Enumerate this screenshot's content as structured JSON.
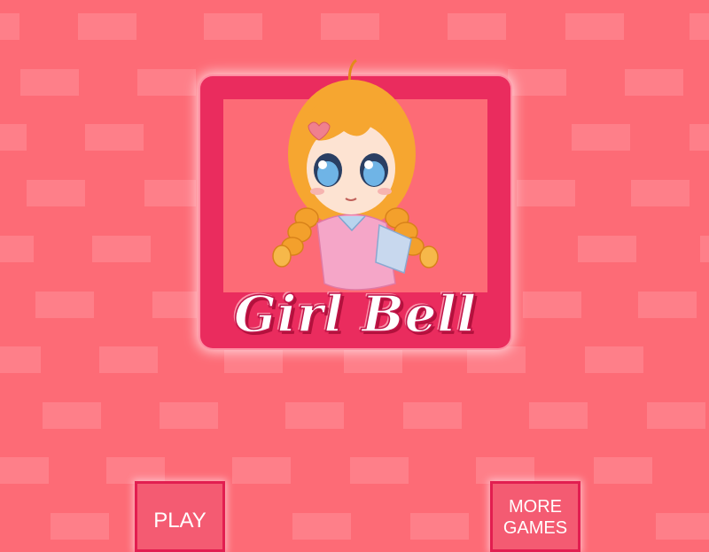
{
  "logo": {
    "title": "Girl Bell",
    "mascot_icon": "chibi-girl-with-braids"
  },
  "menu": {
    "play_label": "PLAY",
    "more_games_label": "MORE GAMES"
  },
  "colors": {
    "background": "#fd6b76",
    "brick": "#fe7f89",
    "frame": "#ea2c5e",
    "button_border": "#e21e50"
  }
}
